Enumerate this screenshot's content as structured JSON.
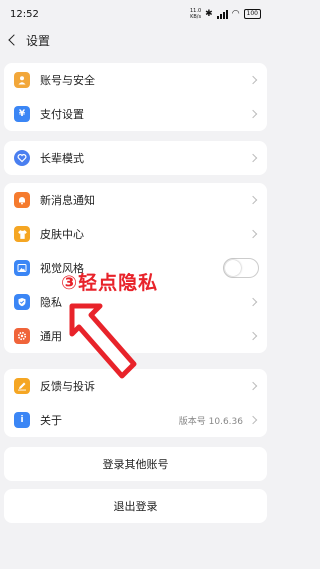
{
  "status": {
    "time": "12:52",
    "net_speed_top": "11.0",
    "net_speed_bottom": "KB/s",
    "battery": "100"
  },
  "header": {
    "title": "设置"
  },
  "groups": {
    "g1": [
      {
        "label": "账号与安全",
        "icon": "person-icon",
        "color": "#f2a73a"
      },
      {
        "label": "支付设置",
        "icon": "yen-icon",
        "color": "#3b86f5"
      }
    ],
    "g2": [
      {
        "label": "长辈模式",
        "icon": "heart-icon",
        "color": "#4a7ff0"
      }
    ],
    "g3": [
      {
        "label": "新消息通知",
        "icon": "bell-icon",
        "color": "#f57b2e"
      },
      {
        "label": "皮肤中心",
        "icon": "shirt-icon",
        "color": "#f5a623"
      },
      {
        "label": "视觉风格 ",
        "icon": "image-icon",
        "color": "#3b86f5"
      },
      {
        "label": "隐私",
        "icon": "shield-icon",
        "color": "#3b86f5"
      },
      {
        "label": "通用",
        "icon": "gear-icon",
        "color": "#f0643a"
      }
    ],
    "g4": [
      {
        "label": "反馈与投诉",
        "icon": "pencil-icon",
        "color": "#f5a623"
      },
      {
        "label": "关于",
        "icon": "info-icon",
        "color": "#3b86f5",
        "value": "版本号 10.6.36"
      }
    ]
  },
  "buttons": {
    "login_other": "登录其他账号",
    "logout": "退出登录"
  },
  "annotation": {
    "text": "③轻点隐私",
    "color": "#e8232a"
  }
}
